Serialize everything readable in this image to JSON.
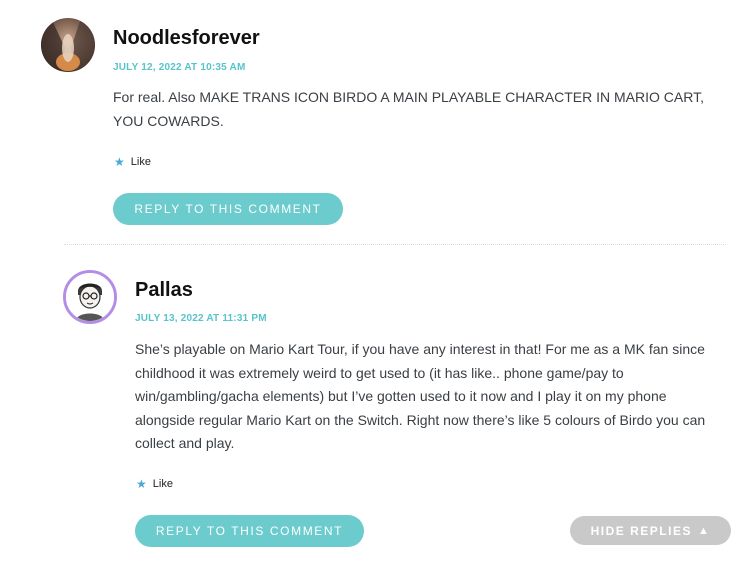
{
  "comments": [
    {
      "author": "Noodlesforever",
      "date": "JULY 12, 2022 AT 10:35 AM",
      "body": "For real. Also MAKE TRANS ICON BIRDO A MAIN PLAYABLE CHARACTER IN MARIO CART, YOU COWARDS.",
      "like_label": "Like",
      "reply_label": "REPLY TO THIS COMMENT"
    },
    {
      "author": "Pallas",
      "date": "JULY 13, 2022 AT 11:31 PM",
      "body": "She’s playable on Mario Kart Tour, if you have any interest in that! For me as a MK fan since childhood it was extremely weird to get used to (it has like.. phone game/pay to win/gambling/gacha elements) but I’ve gotten used to it now and I play it on my phone alongside regular Mario Kart on the Switch. Right now there’s like 5 colours of Birdo you can collect and play.",
      "like_label": "Like",
      "reply_label": "REPLY TO THIS COMMENT"
    }
  ],
  "hide_replies_label": "HIDE REPLIES",
  "hide_replies_icon": "triangle-up-icon",
  "colors": {
    "accent": "#6bcbcd",
    "date": "#56c4c9",
    "like_star": "#4aa8d8",
    "hide_button": "#c9c9c9",
    "reply_avatar_ring": "#b48ee6"
  }
}
